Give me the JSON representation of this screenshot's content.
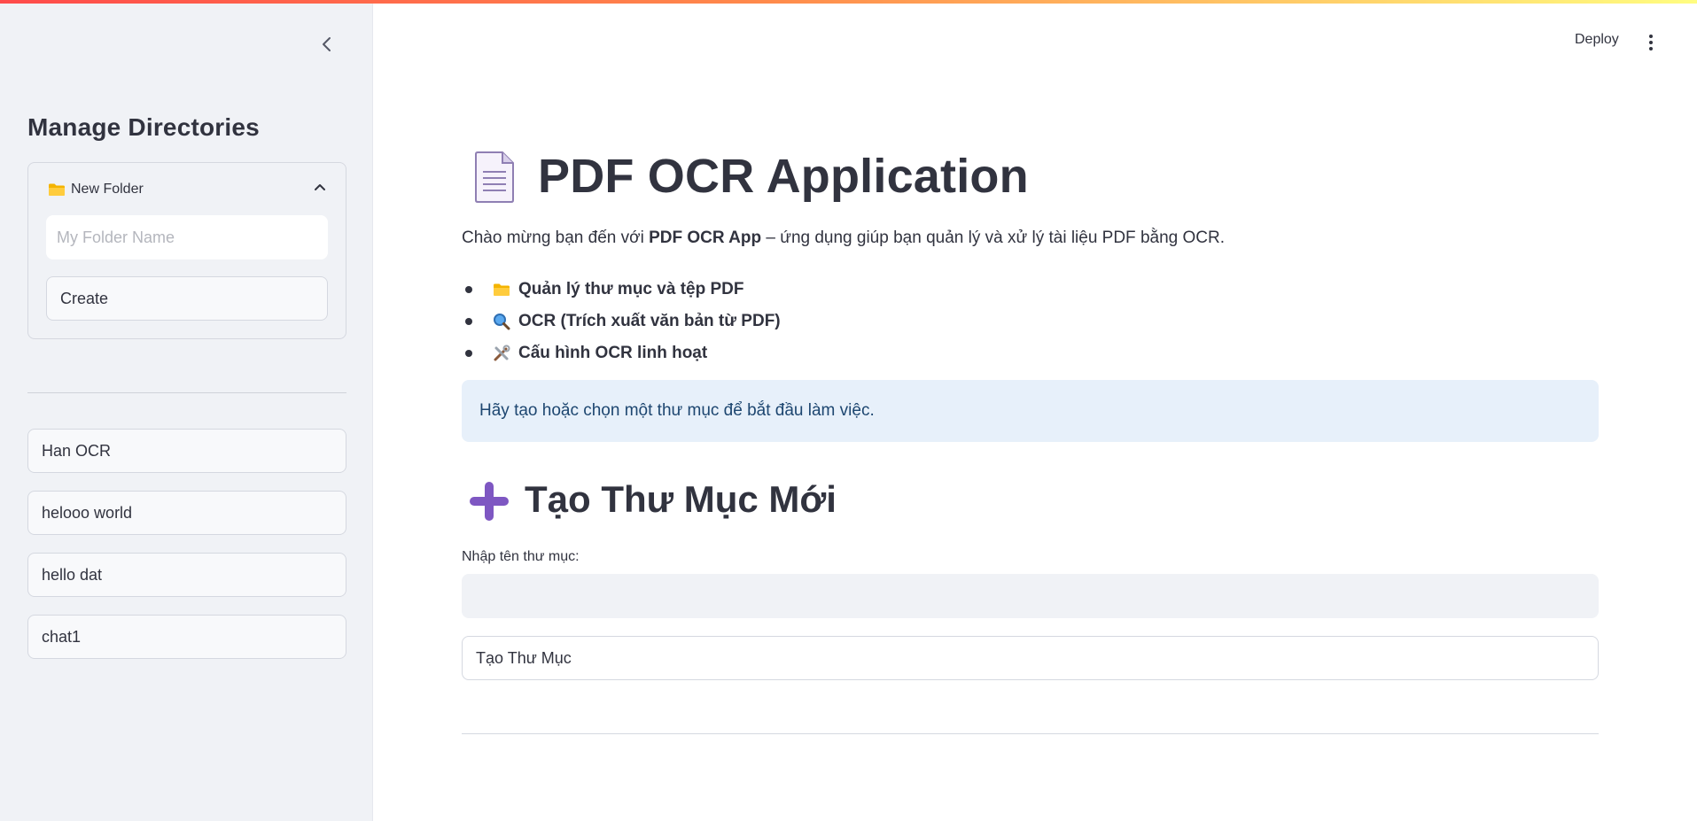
{
  "colors": {
    "accent_gradient": [
      "#ff4b4b",
      "#ffd36b",
      "#fffd80"
    ],
    "sidebar_bg": "#f0f2f6",
    "info_bg": "#e7f0fa",
    "info_text": "#1d4670",
    "plus_icon": "#7e57c2",
    "text": "#31333f"
  },
  "header": {
    "deploy_label": "Deploy",
    "menu_icon": "kebab-menu-icon"
  },
  "sidebar": {
    "collapse_icon": "chevron-left-icon",
    "title": "Manage Directories",
    "expander": {
      "icon": "folder-icon",
      "label": "New Folder",
      "toggle_icon": "chevron-up-icon",
      "input_placeholder": "My Folder Name",
      "input_value": "",
      "create_label": "Create"
    },
    "directories": [
      {
        "label": "Han OCR"
      },
      {
        "label": "helooo world"
      },
      {
        "label": "hello dat"
      },
      {
        "label": "chat1"
      }
    ]
  },
  "main": {
    "title_icon": "document-icon",
    "title": "PDF OCR Application",
    "intro": {
      "before": "Chào mừng bạn đến với ",
      "bold": "PDF OCR App",
      "after": " – ứng dụng giúp bạn quản lý và xử lý tài liệu PDF bằng OCR."
    },
    "features": [
      {
        "icon": "folder-icon",
        "label": "Quản lý thư mục và tệp PDF"
      },
      {
        "icon": "magnifier-icon",
        "label": "OCR (Trích xuất văn bản từ PDF)"
      },
      {
        "icon": "tools-icon",
        "label": "Cấu hình OCR linh hoạt"
      }
    ],
    "info_message": "Hãy tạo hoặc chọn một thư mục để bắt đầu làm việc.",
    "section_icon": "plus-icon",
    "section_title": "Tạo Thư Mục Mới",
    "field_label": "Nhập tên thư mục:",
    "field_value": "",
    "create_button_label": "Tạo Thư Mục"
  }
}
